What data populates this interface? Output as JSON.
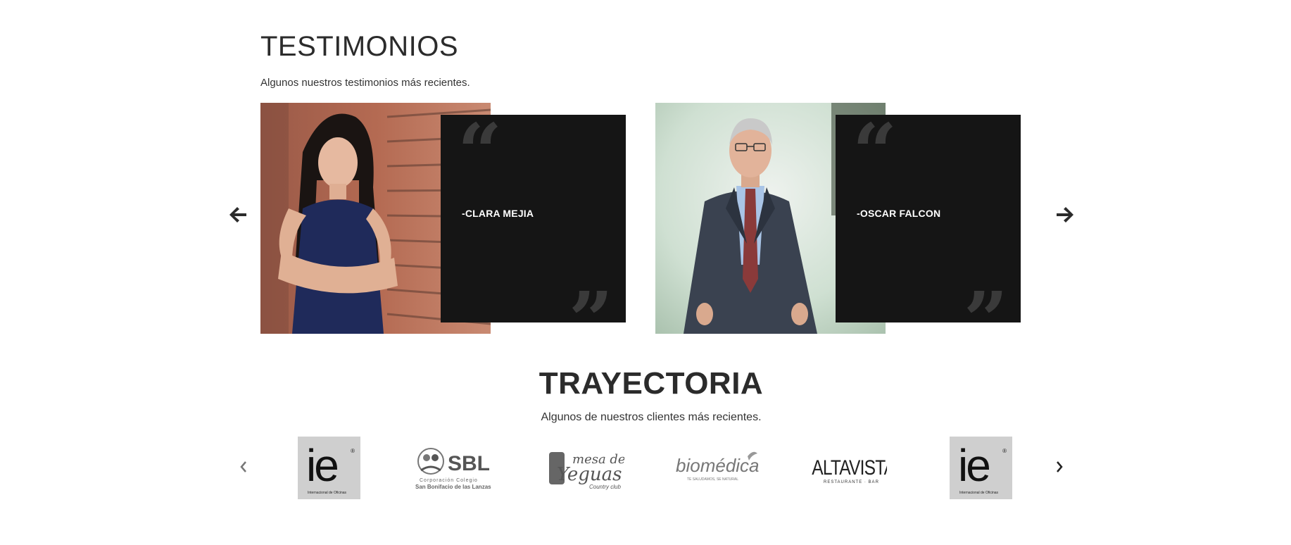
{
  "testimonios": {
    "title": "TESTIMONIOS",
    "subtitle": "Algunos nuestros testimonios más recientes.",
    "cards": [
      {
        "author": "-CLARA MEJIA"
      },
      {
        "author": "-OSCAR FALCON"
      }
    ],
    "quote_open_glyph": "“",
    "quote_close_glyph": "”",
    "quote_box_color": "#151515"
  },
  "trayectoria": {
    "title": "TRAYECTORIA",
    "subtitle": "Algunos de nuestros clientes más recientes.",
    "logos": [
      {
        "name": "ie",
        "small": "Internacional de Oficinas"
      },
      {
        "name": "SBL",
        "line1": "Corporación  Colegio",
        "line2": "San Bonifacio de las Lanzas"
      },
      {
        "name": "mesa de Yeguas",
        "line1": "mesa de",
        "line2": "Yeguas",
        "line3": "Country club"
      },
      {
        "name": "biomédica",
        "tagline": "TE SALUDAMOS, SE NATURAL"
      },
      {
        "name": "ALTAVISTA",
        "tagline": "RESTAURANTE · BAR"
      },
      {
        "name": "ie",
        "small": "Internacional de Oficinas"
      }
    ]
  },
  "icons": {
    "prev_testimonial": "arrow-left-icon",
    "next_testimonial": "arrow-right-icon",
    "prev_logo": "chevron-left-icon",
    "next_logo": "chevron-right-icon"
  }
}
